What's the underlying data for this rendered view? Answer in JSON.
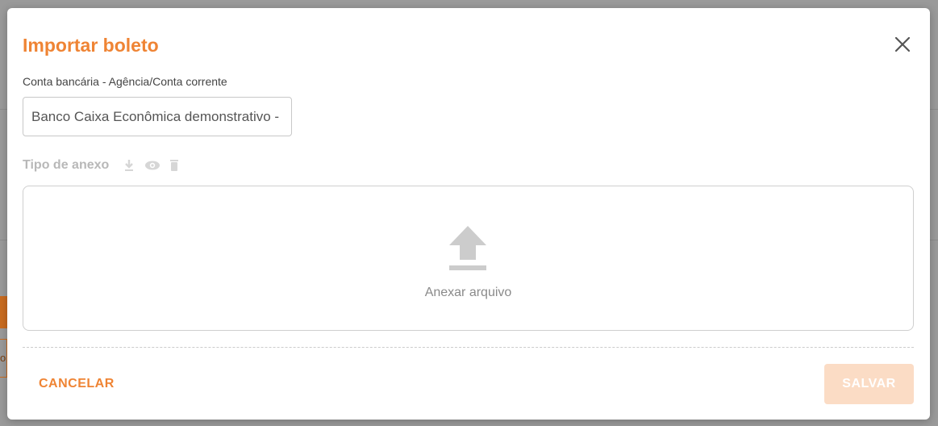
{
  "modal": {
    "title": "Importar boleto",
    "close_icon": "close-icon"
  },
  "account_field": {
    "label": "Conta bancária - Agência/Conta corrente",
    "value": "Banco Caixa Econômica demonstrativo -"
  },
  "attachment": {
    "label": "Tipo de anexo",
    "icons": [
      "download-icon",
      "eye-icon",
      "trash-icon"
    ],
    "icon_color": "#d6d6d6"
  },
  "dropzone": {
    "icon": "upload-icon",
    "text": "Anexar arquivo"
  },
  "actions": {
    "cancel_label": "CANCELAR",
    "save_label": "SALVAR"
  },
  "colors": {
    "accent": "#ef8434",
    "save_disabled_bg": "#fbdcc5",
    "backdrop": "#9a9a9a"
  },
  "background": {
    "partial_text": "o"
  }
}
